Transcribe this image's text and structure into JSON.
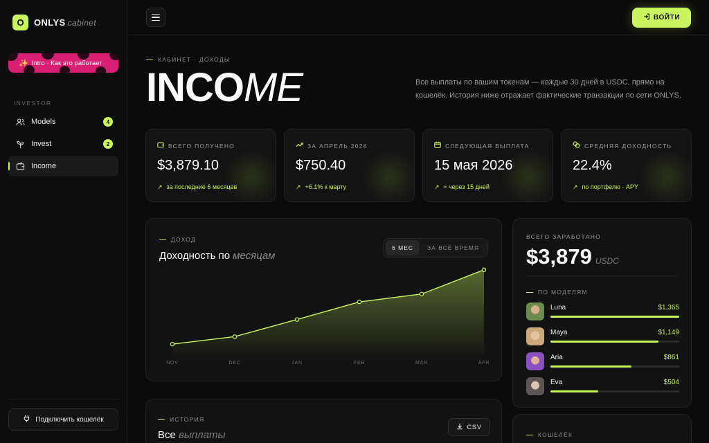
{
  "brand": {
    "logo_letter": "O",
    "name": "ONLYS",
    "sub": "cabinet"
  },
  "sidebar": {
    "intro_label": "Intro · Как это работает",
    "section_label": "INVESTOR",
    "items": [
      {
        "label": "Models",
        "badge": "4",
        "icon": "users-icon"
      },
      {
        "label": "Invest",
        "badge": "2",
        "icon": "plant-icon"
      },
      {
        "label": "Income",
        "badge": "",
        "icon": "wallet-icon"
      }
    ],
    "connect_wallet_label": "Подключить кошелёк"
  },
  "topbar": {
    "login_label": "ВОЙТИ"
  },
  "header": {
    "eyebrow": "КАБИНЕТ · ДОХОДЫ",
    "title_bold": "INCO",
    "title_thin": "ME",
    "description": "Все выплаты по вашим токенам — каждые 30 дней в USDC, прямо на кошелёк. История ниже отражает фактические транзакции по сети ONLYS."
  },
  "stats": [
    {
      "label": "ВСЕГО ПОЛУЧЕНО",
      "value": "$3,879.10",
      "sub": "за последние 6 месяцев",
      "icon": "wallet-icon"
    },
    {
      "label": "ЗА АПРЕЛЬ 2026",
      "value": "$750.40",
      "sub": "+6.1% к марту",
      "icon": "trend-up-icon"
    },
    {
      "label": "СЛЕДУЮЩАЯ ВЫПЛАТА",
      "value": "15 мая 2026",
      "sub": "≈ через 15 дней",
      "icon": "calendar-icon"
    },
    {
      "label": "СРЕДНЯЯ ДОХОДНОСТЬ",
      "value": "22.4%",
      "sub": "по портфелю · APY",
      "icon": "coins-icon"
    }
  ],
  "chart_card": {
    "eyebrow": "ДОХОД",
    "title_main": "Доходность по",
    "title_italic": "месяцам",
    "toggle": [
      "6 МЕС",
      "ЗА ВСЁ ВРЕМЯ"
    ],
    "toggle_selected": "6 МЕС"
  },
  "chart_data": {
    "type": "area",
    "categories": [
      "NOV",
      "DEC",
      "JAN",
      "FEB",
      "MAR",
      "APR"
    ],
    "series": [
      {
        "values": [
          0.5,
          0.84,
          1.62,
          2.42,
          2.78,
          3.88
        ]
      }
    ],
    "ylim": [
      0,
      4.0
    ],
    "grid": false,
    "color": "#c8f560"
  },
  "earnings": {
    "label": "ВСЕГО ЗАРАБОТАНО",
    "value": "$3,879",
    "unit": "USDC",
    "by_models_label": "ПО МОДЕЛЯМ",
    "models": [
      {
        "name": "Luna",
        "amount": "$1,365",
        "share": 1.0
      },
      {
        "name": "Maya",
        "amount": "$1,149",
        "share": 0.84
      },
      {
        "name": "Aria",
        "amount": "$861",
        "share": 0.63
      },
      {
        "name": "Eva",
        "amount": "$504",
        "share": 0.37
      }
    ]
  },
  "history": {
    "eyebrow": "ИСТОРИЯ",
    "title_main": "Все",
    "title_italic": "выплаты",
    "csv_label": "CSV"
  },
  "wallet_card": {
    "eyebrow": "КОШЕЛЁК"
  },
  "colors": {
    "accent": "#c8f560",
    "background": "#0b0b0b",
    "card": "#131313",
    "intro": "#d81f74"
  }
}
